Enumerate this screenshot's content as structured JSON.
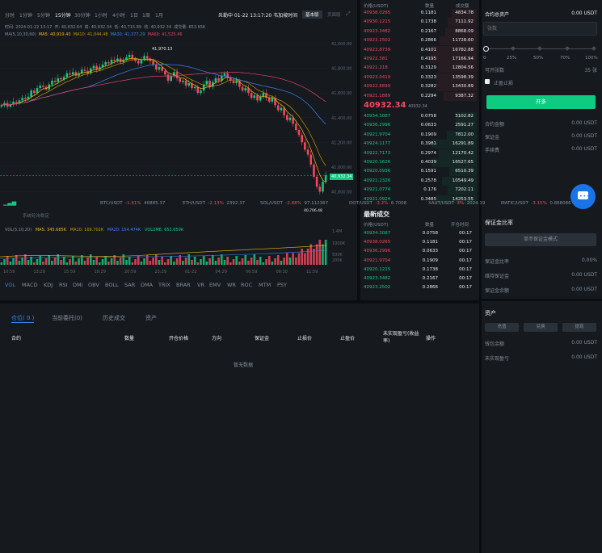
{
  "toolbar": {
    "timeframes": [
      "分时",
      "1分钟",
      "5分钟",
      "15分钟",
      "30分钟",
      "1小时",
      "4小时",
      "1日",
      "1周",
      "1月"
    ],
    "active_timeframe": "15分钟",
    "clock": "炎勒中 01-22 13:17:20 韦加坡时间",
    "basic_btn": "基本版",
    "pro_btn": "页面版"
  },
  "chart_info": {
    "time_label": "时间:",
    "time_value": "2024-01-22 13:17",
    "open_label": "开:",
    "open_value": "40,832.64",
    "high_label": "高:",
    "high_value": "40,932.34",
    "low_label": "低:",
    "low_value": "40,715.89",
    "close_label": "收:",
    "close_value": "40,932.34",
    "vol_label": "成交量:",
    "vol_value": "653.65K",
    "ma_line": [
      "MA(5,10,30,60)",
      "MA5: 40,919.40",
      "MA10: 41,044.48",
      "MA30: 41,377.29",
      "MA60: 41,525.46"
    ],
    "max_marker": "41,970.13",
    "min_marker": "40,706.48",
    "current_price_tag": "40,932.34"
  },
  "chart_data": {
    "type": "candlestick",
    "y_ticks": [
      "42,000.00",
      "41,800.00",
      "41,600.00",
      "41,400.00",
      "41,200.00",
      "41,000.00",
      "40,800.00"
    ],
    "ylim": [
      40750,
      42060
    ],
    "x_ticks": [
      "10:59",
      "13:29",
      "15:59",
      "18:29",
      "20:59",
      "23:29",
      "01-22",
      "04:29",
      "06:59",
      "09:30",
      "11:59"
    ],
    "candles": [
      41500,
      41520,
      41490,
      41510,
      41530,
      41520,
      41540,
      41560,
      41550,
      41570,
      41620,
      41600,
      41640,
      41660,
      41650,
      41630,
      41670,
      41700,
      41690,
      41720,
      41710,
      41730,
      41760,
      41750,
      41770,
      41740,
      41760,
      41790,
      41780,
      41760,
      41800,
      41820,
      41790,
      41810,
      41830,
      41850,
      41840,
      41870,
      41860,
      41880,
      41850,
      41870,
      41890,
      41910,
      41880,
      41860,
      41840,
      41870,
      41900,
      41880,
      41860,
      41830,
      41790,
      41810,
      41780,
      41750,
      41700,
      41740,
      41770,
      41720,
      41690,
      41700,
      41660,
      41680,
      41640,
      41650,
      41600,
      41620,
      41670,
      41700,
      41650,
      41690,
      41720,
      41700,
      41740,
      41760,
      41720,
      41700,
      41680,
      41700,
      41650,
      41620,
      41640,
      41600,
      41560,
      41580,
      41540,
      41570,
      41600,
      41560,
      41530,
      41560,
      41500,
      41460,
      41480,
      41420,
      41380,
      41400,
      41350,
      41300,
      41260,
      41200,
      41140,
      41100,
      41020,
      40920,
      40840,
      40800,
      40880,
      40932
    ]
  },
  "volume_info": {
    "label": "VOL(5,10,20)",
    "ma5": "MA5: 345.685K",
    "ma10": "MA10: 169.702K",
    "ma20": "MA20: 154.474K",
    "volume": "VOLUME: 653.659K",
    "y_ticks": [
      "1.4M",
      "1000K",
      "500K",
      "200K"
    ]
  },
  "watermark": "系统轮询稳定",
  "ticker_bar": [
    {
      "sym": "BTC/USDT",
      "chg": "-1.61%",
      "price": "40885.37"
    },
    {
      "sym": "ETH/USDT",
      "chg": "-2.13%",
      "price": "2392.37"
    },
    {
      "sym": "SOL/USDT",
      "chg": "-2.88%",
      "price": "97.112367"
    },
    {
      "sym": "DOT/USDT",
      "chg": "-3.2%",
      "price": "6.7008"
    },
    {
      "sym": "XAUT/USDT",
      "chg": "3%",
      "price": "2024.19"
    },
    {
      "sym": "MATIC/USDT",
      "chg": "-3.15%",
      "price": "0.868086"
    }
  ],
  "indicators": [
    "VOL",
    "MACD",
    "KDJ",
    "RSI",
    "DMI",
    "OBV",
    "BOLL",
    "SAR",
    "DMA",
    "TRIX",
    "BRAR",
    "VR",
    "EMV",
    "WR",
    "ROC",
    "MTM",
    "PSY"
  ],
  "orderbook": {
    "headers": [
      "价格(USDT)",
      "数量",
      "成交额"
    ],
    "asks": [
      [
        "40938.0265",
        "0.1181",
        "4834.78"
      ],
      [
        "40930.1215",
        "0.1738",
        "7111.92"
      ],
      [
        "40923.3482",
        "0.2167",
        "8868.09"
      ],
      [
        "40923.2502",
        "0.2866",
        "11728.60"
      ],
      [
        "40923.8739",
        "0.4101",
        "16782.88"
      ],
      [
        "40922.381",
        "0.4195",
        "17166.94"
      ],
      [
        "40921.218",
        "0.3129",
        "12804.56"
      ],
      [
        "40923.0419",
        "0.3323",
        "13598.39"
      ],
      [
        "40922.8899",
        "0.3282",
        "13430.89"
      ],
      [
        "40921.1889",
        "0.2294",
        "9387.32"
      ]
    ],
    "last_price": "40932.34",
    "last_price_sub": "40932.34",
    "bids": [
      [
        "40934.3087",
        "0.0758",
        "3102.82"
      ],
      [
        "40936.2996",
        "0.0633",
        "2591.27"
      ],
      [
        "40921.9704",
        "0.1909",
        "7812.00"
      ],
      [
        "40924.1177",
        "0.3981",
        "16291.89"
      ],
      [
        "40922.7173",
        "0.2974",
        "12170.42"
      ],
      [
        "40920.1626",
        "0.4039",
        "16527.65"
      ],
      [
        "40920.0936",
        "0.1591",
        "6510.39"
      ],
      [
        "40921.2326",
        "0.2578",
        "10549.49"
      ],
      [
        "40921.0774",
        "0.176",
        "7202.11"
      ],
      [
        "40921.0924",
        "0.3485",
        "14253.55"
      ]
    ]
  },
  "trades": {
    "title": "最新成交",
    "headers": [
      "价格(USDT)",
      "数量",
      "开仓时间"
    ],
    "rows": [
      [
        "40934.3087",
        "0.0758",
        "00:17",
        "green"
      ],
      [
        "40938.0265",
        "0.1181",
        "00:17",
        "red"
      ],
      [
        "40936.2996",
        "0.0633",
        "00:17",
        "red"
      ],
      [
        "40921.9704",
        "0.1909",
        "00:17",
        "red"
      ],
      [
        "40920.1215",
        "0.1738",
        "00:17",
        "green"
      ],
      [
        "40923.3482",
        "0.2167",
        "00:17",
        "green"
      ],
      [
        "40923.2502",
        "0.2866",
        "00:17",
        "green"
      ]
    ]
  },
  "trade_panel": {
    "contract_assets_label": "合约总资产",
    "contract_assets_value": "0.00 USDT",
    "qty_placeholder": "张数",
    "slider_marks": [
      "0",
      "25%",
      "50%",
      "70%",
      "100%"
    ],
    "available_label": "可开张数",
    "available_value": "35 张",
    "tpsl_label": "止盈止损",
    "open_button": "开多",
    "contract_amount_label": "合约金额",
    "contract_amount_value": "0.00 USDT",
    "margin_label": "保证金",
    "margin_value": "0.00 USDT",
    "fee_label": "手续费",
    "fee_value": "0.00 USDT"
  },
  "margin_panel": {
    "title": "保证金比率",
    "mode_button": "单币保证金模式",
    "ratio_label": "保证金比率",
    "ratio_value": "0.00%",
    "maint_label": "维持保证金",
    "maint_value": "0.00 USDT",
    "balance_label": "保证金余额",
    "balance_value": "0.00 USDT"
  },
  "assets_panel": {
    "title": "资产",
    "buttons": [
      "充值",
      "兑换",
      "提现"
    ],
    "wallet_label": "钱包余额",
    "wallet_value": "0.00 USDT",
    "pnl_label": "未实现盈亏",
    "pnl_value": "0.00 USDT"
  },
  "positions": {
    "tabs": [
      "仓位( 0 )",
      "当前委托(0)",
      "历史成交",
      "资产"
    ],
    "columns": [
      "合约",
      "数量",
      "开仓价格",
      "方向",
      "保证金",
      "止损价",
      "止盈价",
      "未实现盈亏(收益率)",
      "操作"
    ],
    "empty": "暂无数据"
  },
  "colors": {
    "up": "#0ecb81",
    "down": "#f6465d",
    "accent": "#f0b90b",
    "bg": "#161a1e"
  }
}
